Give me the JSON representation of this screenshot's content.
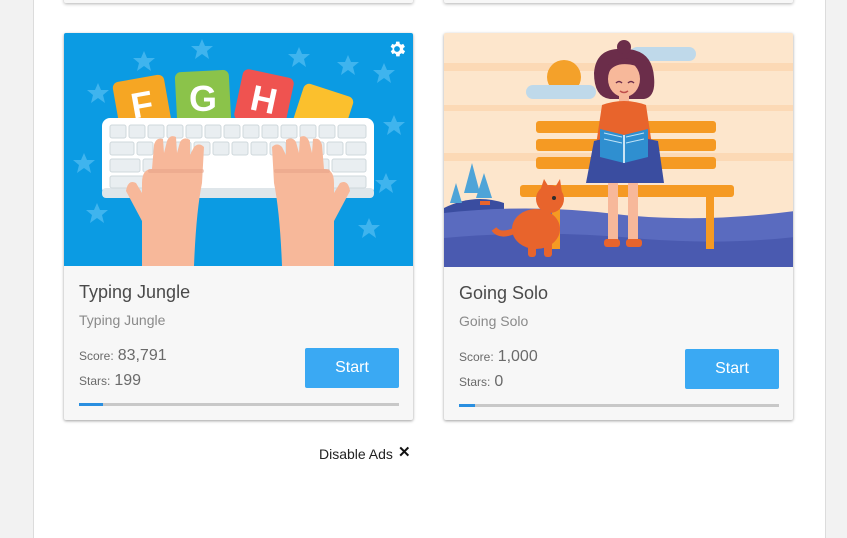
{
  "cards": [
    {
      "title": "Typing Jungle",
      "subtitle": "Typing Jungle",
      "score_label": "Score:",
      "score": "83,791",
      "stars_label": "Stars:",
      "stars": "199",
      "start_label": "Start",
      "progress": 0.075,
      "image_icon": "keyboard-letters-illustration",
      "has_settings": true
    },
    {
      "title": "Going Solo",
      "subtitle": "Going Solo",
      "score_label": "Score:",
      "score": "1,000",
      "stars_label": "Stars:",
      "stars": "0",
      "start_label": "Start",
      "progress": 0.05,
      "image_icon": "woman-reading-bench-illustration",
      "has_settings": false
    }
  ],
  "footer": {
    "disable_ads_label": "Disable Ads",
    "close_symbol": "✕"
  },
  "colors": {
    "accent": "#3aa9f3",
    "progress_fill": "#2a8fe0",
    "card_bg": "#f7f7f7"
  }
}
